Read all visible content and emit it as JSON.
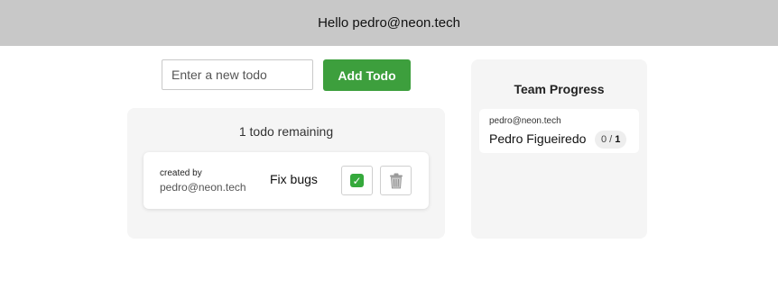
{
  "header": {
    "greeting": "Hello pedro@neon.tech"
  },
  "todo_form": {
    "input_placeholder": "Enter a new todo",
    "input_value": "",
    "add_button_label": "Add Todo",
    "add_button_color": "#3d9f3d"
  },
  "todo_list": {
    "remaining_text": "1 todo remaining",
    "items": [
      {
        "created_by_label": "created by",
        "creator_email": "pedro@neon.tech",
        "text": "Fix bugs",
        "done_icon": "check-mark-icon",
        "delete_icon": "trash-icon"
      }
    ]
  },
  "team_progress": {
    "title": "Team Progress",
    "members": [
      {
        "email": "pedro@neon.tech",
        "name": "Pedro Figueiredo",
        "completed": "0",
        "separator": "/",
        "total": "1"
      }
    ]
  }
}
